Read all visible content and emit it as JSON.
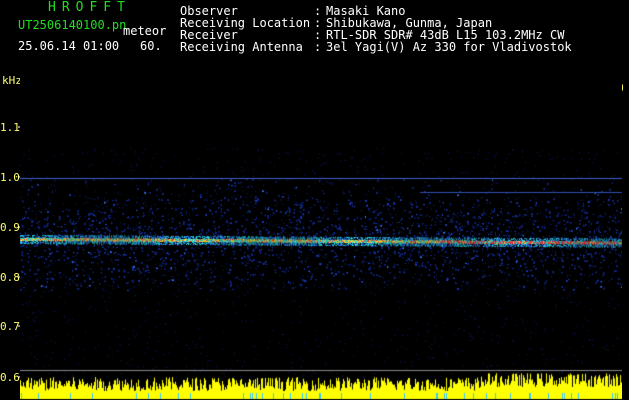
{
  "header": {
    "app_title": "HROFFT",
    "file_name": "UT2506140100.pn",
    "mode": "meteor",
    "timestamp": "25.06.14 01:00",
    "count": "60.",
    "observer_label": "Observer",
    "observer_value": "Masaki Kano",
    "location_label": "Receiving Location",
    "location_value": "Shibukawa, Gunma, Japan",
    "receiver_label": "Receiver",
    "receiver_value": "RTL-SDR SDR# 43dB L15 103.2MHz CW",
    "antenna_label": "Receiving Antenna",
    "antenna_value": "3el Yagi(V) Az 330 for Vladivostok",
    "separator": ":"
  },
  "plot": {
    "y_unit": "kHz",
    "y_ticks": [
      "1.1",
      "1.0",
      "0.9",
      "0.8",
      "0.7",
      "0.6"
    ],
    "time_labels": [
      "010",
      "010",
      "010",
      "010",
      "010",
      "010",
      "010",
      "010",
      "010",
      "0110"
    ],
    "colors": {
      "background": "#000000",
      "noise": "#1a2a9a",
      "band_mid": "#22dddd",
      "band_hot": "#ff3333",
      "tick_labels": "#ffff66",
      "level_bars": "#ffff00"
    }
  }
}
